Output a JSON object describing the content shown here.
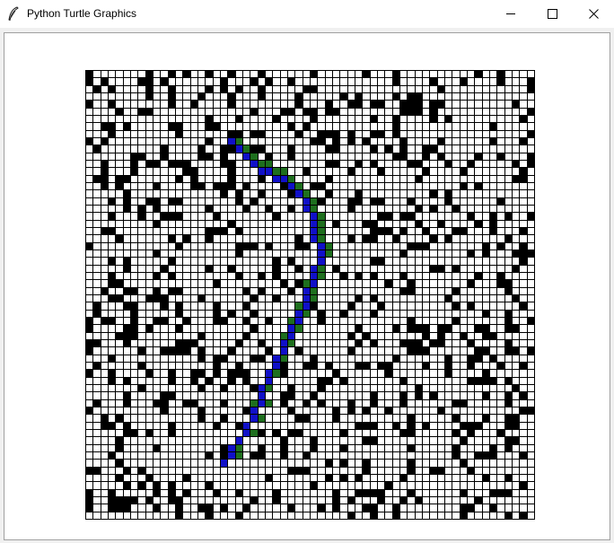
{
  "window": {
    "title": "Python Turtle Graphics",
    "app_icon": "feather-pen-icon",
    "controls": {
      "minimize_icon": "minimize-icon",
      "maximize_icon": "maximize-icon",
      "close_icon": "close-icon"
    }
  },
  "maze": {
    "columns": 60,
    "rows": 60,
    "obstacle_density": 0.22,
    "colors": {
      "grid_line": "#000000",
      "open": "#ffffff",
      "obstacle": "#000000",
      "explored": "#1e6f1e",
      "path": "#1010c8"
    },
    "path_cells": [
      [
        19,
        9
      ],
      [
        20,
        10
      ],
      [
        21,
        11
      ],
      [
        22,
        12
      ],
      [
        23,
        13
      ],
      [
        24,
        13
      ],
      [
        25,
        14
      ],
      [
        26,
        14
      ],
      [
        27,
        15
      ],
      [
        28,
        16
      ],
      [
        29,
        17
      ],
      [
        29,
        18
      ],
      [
        30,
        19
      ],
      [
        30,
        20
      ],
      [
        30,
        21
      ],
      [
        30,
        22
      ],
      [
        31,
        23
      ],
      [
        31,
        24
      ],
      [
        31,
        25
      ],
      [
        30,
        26
      ],
      [
        30,
        27
      ],
      [
        30,
        28
      ],
      [
        29,
        29
      ],
      [
        29,
        30
      ],
      [
        29,
        31
      ],
      [
        28,
        32
      ],
      [
        28,
        33
      ],
      [
        27,
        34
      ],
      [
        27,
        35
      ],
      [
        26,
        36
      ],
      [
        26,
        37
      ],
      [
        25,
        38
      ],
      [
        25,
        39
      ],
      [
        24,
        40
      ],
      [
        24,
        41
      ],
      [
        23,
        42
      ],
      [
        23,
        43
      ],
      [
        23,
        44
      ],
      [
        22,
        45
      ],
      [
        22,
        46
      ],
      [
        21,
        47
      ],
      [
        21,
        48
      ],
      [
        20,
        49
      ],
      [
        19,
        50
      ],
      [
        19,
        51
      ],
      [
        18,
        52
      ]
    ],
    "explored_cells": [
      [
        20,
        9
      ],
      [
        21,
        10
      ],
      [
        22,
        11
      ],
      [
        23,
        12
      ],
      [
        24,
        12
      ],
      [
        25,
        13
      ],
      [
        26,
        13
      ],
      [
        27,
        14
      ],
      [
        28,
        15
      ],
      [
        29,
        16
      ],
      [
        30,
        17
      ],
      [
        30,
        18
      ],
      [
        31,
        19
      ],
      [
        31,
        20
      ],
      [
        31,
        21
      ],
      [
        31,
        22
      ],
      [
        32,
        23
      ],
      [
        32,
        24
      ],
      [
        31,
        26
      ],
      [
        31,
        27
      ],
      [
        30,
        29
      ],
      [
        30,
        30
      ],
      [
        29,
        32
      ],
      [
        28,
        34
      ],
      [
        27,
        36
      ],
      [
        26,
        38
      ],
      [
        25,
        40
      ],
      [
        24,
        42
      ],
      [
        24,
        44
      ],
      [
        23,
        46
      ],
      [
        22,
        48
      ],
      [
        20,
        50
      ],
      [
        20,
        51
      ],
      [
        22,
        44
      ],
      [
        28,
        31
      ],
      [
        29,
        28
      ],
      [
        27,
        33
      ],
      [
        26,
        35
      ]
    ]
  }
}
